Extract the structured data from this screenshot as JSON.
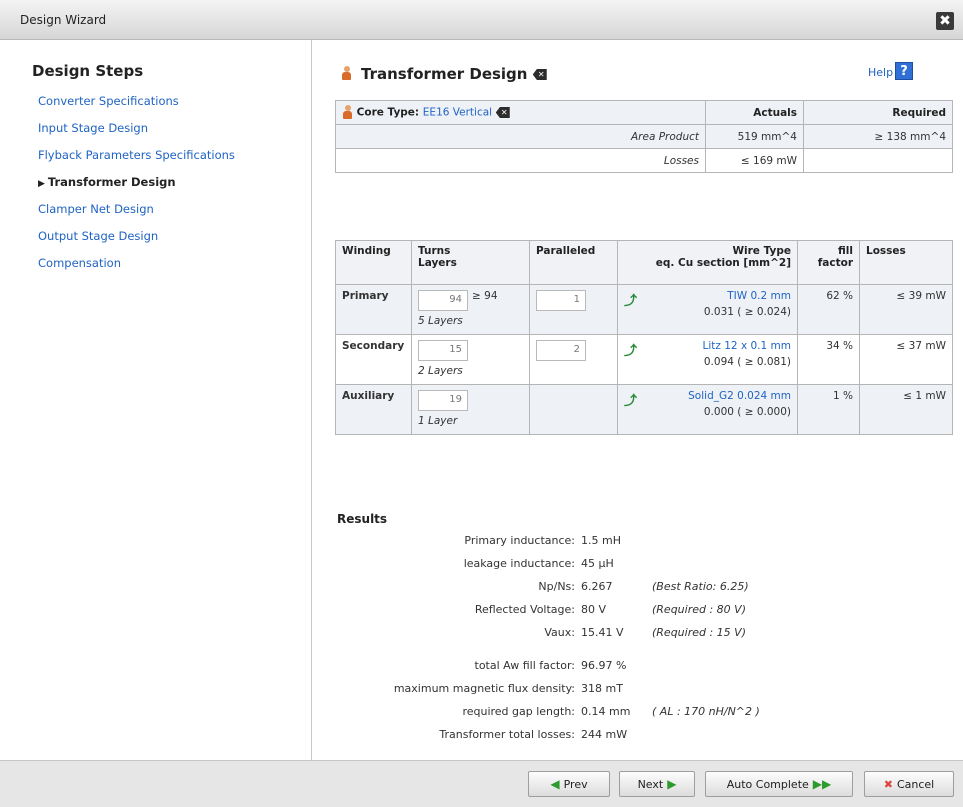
{
  "window": {
    "title": "Design Wizard",
    "close_glyph": "✖"
  },
  "sidebar": {
    "heading": "Design Steps",
    "items": [
      {
        "label": "Converter Specifications"
      },
      {
        "label": "Input Stage Design"
      },
      {
        "label": "Flyback Parameters Specifications"
      },
      {
        "label": "Transformer Design"
      },
      {
        "label": "Clamper Net Design"
      },
      {
        "label": "Output Stage Design"
      },
      {
        "label": "Compensation"
      }
    ],
    "current_index": 3
  },
  "main": {
    "title": "Transformer Design",
    "help_label": "Help",
    "help_icon": "?",
    "core": {
      "label": "Core Type:",
      "value": "EE16 Vertical",
      "actuals_header": "Actuals",
      "required_header": "Required",
      "rows": [
        {
          "name": "Area Product",
          "actual": "519 mm^4",
          "required": "≥ 138 mm^4"
        },
        {
          "name": "Losses",
          "actual": "≤ 169 mW",
          "required": ""
        }
      ]
    },
    "winding": {
      "headers": {
        "winding": "Winding",
        "turns": "Turns",
        "layers": "Layers",
        "paralleled": "Paralleled",
        "wire_type": "Wire Type",
        "cu_section": "eq. Cu section [mm^2]",
        "fill_factor": "fill factor",
        "losses": "Losses"
      },
      "rows": [
        {
          "name": "Primary",
          "turns": "94",
          "min": "≥ 94",
          "layers": "5 Layers",
          "paralleled": "1",
          "wire": "TIW 0.2 mm",
          "cu": "0.031 ( ≥ 0.024)",
          "fill": "62 %",
          "losses": "≤ 39 mW"
        },
        {
          "name": "Secondary",
          "turns": "15",
          "min": "",
          "layers": "2 Layers",
          "paralleled": "2",
          "wire": "Litz 12 x 0.1 mm",
          "cu": "0.094 ( ≥ 0.081)",
          "fill": "34 %",
          "losses": "≤ 37 mW"
        },
        {
          "name": "Auxiliary",
          "turns": "19",
          "min": "",
          "layers": "1 Layer",
          "paralleled": "",
          "wire": "Solid_G2 0.024 mm",
          "cu": "0.000 ( ≥ 0.000)",
          "fill": "1 %",
          "losses": "≤ 1 mW"
        }
      ]
    },
    "results": {
      "heading": "Results",
      "group1": [
        {
          "label": "Primary inductance:",
          "value": "1.5 mH",
          "note": ""
        },
        {
          "label": "leakage inductance:",
          "value": "45 µH",
          "note": ""
        },
        {
          "label": "Np/Ns:",
          "value": "6.267",
          "note": "(Best Ratio: 6.25)"
        },
        {
          "label": "Reflected Voltage:",
          "value": "80 V",
          "note": "(Required : 80 V)"
        },
        {
          "label": "Vaux:",
          "value": "15.41 V",
          "note": "(Required : 15 V)"
        }
      ],
      "group2": [
        {
          "label": "total Aw fill factor:",
          "value": "96.97 %",
          "note": ""
        },
        {
          "label": "maximum magnetic flux density:",
          "value": "318 mT",
          "note": ""
        },
        {
          "label": "required gap length:",
          "value": "0.14 mm",
          "note": "( AL : 170 nH/N^2 )"
        },
        {
          "label": "Transformer total losses:",
          "value": "244 mW",
          "note": ""
        }
      ]
    }
  },
  "footer": {
    "prev_label": "Prev",
    "next_label": "Next",
    "auto_label": "Auto Complete",
    "cancel_label": "Cancel"
  }
}
